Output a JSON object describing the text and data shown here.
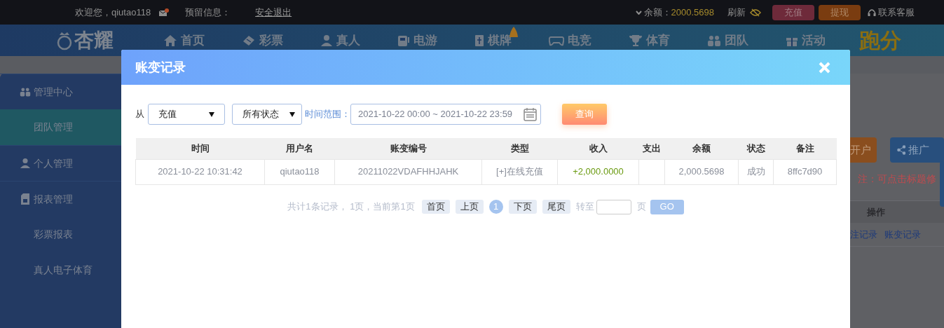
{
  "top_bar": {
    "welcome": "欢迎您，qiutao118",
    "reserved_info": "预留信息：",
    "logout": "安全退出",
    "balance_label": "余额：",
    "balance": "2000.5698",
    "refresh": "刷新",
    "buttons": [
      {
        "label": "充值",
        "kind": "deposit"
      },
      {
        "label": "提现",
        "kind": "withdraw"
      }
    ],
    "support": "联系客服"
  },
  "nav": {
    "logo": "杏耀",
    "items": [
      {
        "label": "首页"
      },
      {
        "label": "彩票"
      },
      {
        "label": "真人"
      },
      {
        "label": "电游"
      },
      {
        "label": "棋牌"
      },
      {
        "label": "电竞"
      },
      {
        "label": "体育"
      },
      {
        "label": "团队"
      },
      {
        "label": "活动"
      }
    ],
    "promo": "跑分"
  },
  "sidebar": {
    "items": [
      {
        "label": "管理中心",
        "kind": "section",
        "selected": false
      },
      {
        "label": "团队管理",
        "kind": "item",
        "selected": true
      },
      {
        "label": "个人管理",
        "kind": "section",
        "selected": false
      },
      {
        "label": "报表管理",
        "kind": "section",
        "selected": false
      },
      {
        "label": "彩票报表",
        "kind": "item",
        "selected": false
      },
      {
        "label": "真人电子体育",
        "kind": "item",
        "selected": false
      }
    ]
  },
  "background": {
    "buttons": [
      "开户",
      "推广"
    ],
    "note": "注：可点击标题修",
    "column": "操作",
    "links": [
      "注记录",
      "账变记录"
    ]
  },
  "modal": {
    "title": "账变记录",
    "filter": {
      "from_label": "从",
      "type_select": "充值",
      "status_select": "所有状态",
      "range_label": "时间范围：",
      "range_value": "2021-10-22 00:00 ~ 2021-10-22 23:59",
      "search_button": "查询"
    },
    "table": {
      "columns": [
        "时间",
        "用户名",
        "账变编号",
        "类型",
        "收入",
        "支出",
        "余额",
        "状态",
        "备注"
      ],
      "rows": [
        {
          "cells": [
            "2021-10-22 10:31:42",
            "qiutao118",
            "20211022VDAFHHJAHK",
            "[+]在线充值",
            "+2,000.0000",
            "",
            "2,000.5698",
            "成功",
            "8ffc7d90"
          ]
        }
      ]
    },
    "pagination": {
      "summary": "共计1条记录， 1页，当前第1页",
      "pages": [
        {
          "label": "首页",
          "kind": "nav"
        },
        {
          "label": "上页",
          "kind": "nav"
        },
        {
          "label": "1",
          "kind": "page",
          "selected": true
        },
        {
          "label": "下页",
          "kind": "nav"
        },
        {
          "label": "尾页",
          "kind": "nav"
        }
      ],
      "goto_label": "转至",
      "page_unit": "页",
      "go_button": "GO"
    }
  }
}
